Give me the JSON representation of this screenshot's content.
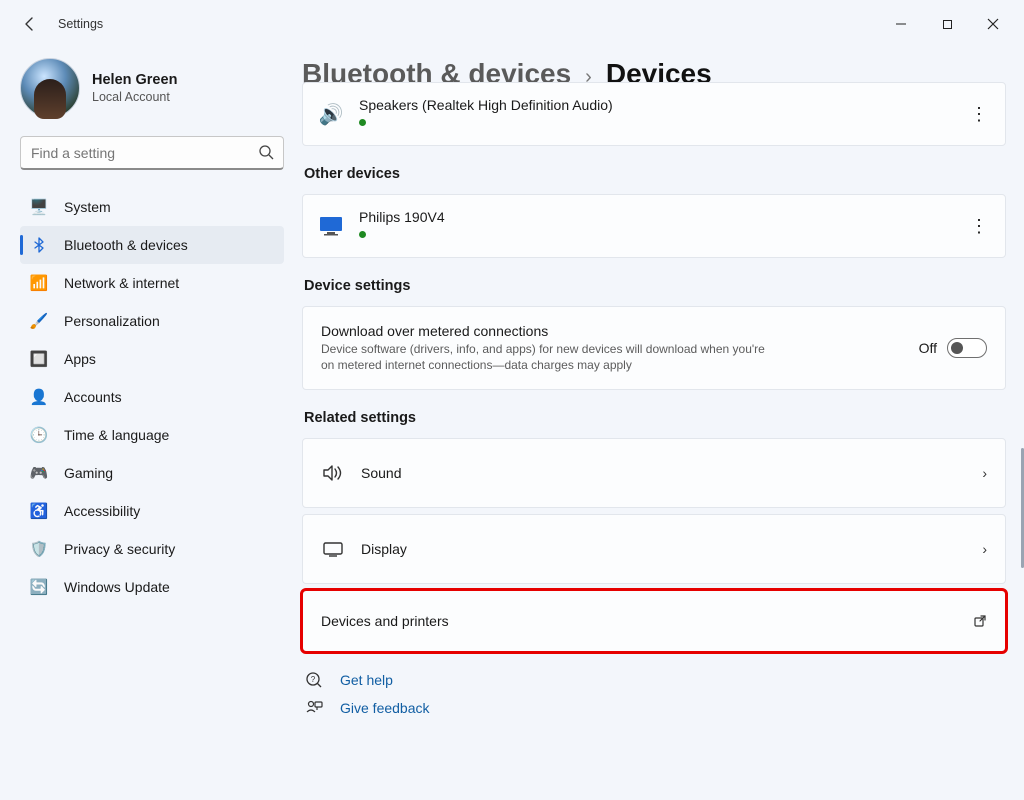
{
  "window": {
    "title": "Settings"
  },
  "profile": {
    "name": "Helen Green",
    "sub": "Local Account"
  },
  "search": {
    "placeholder": "Find a setting"
  },
  "nav": [
    {
      "id": "system",
      "label": "System"
    },
    {
      "id": "bluetooth",
      "label": "Bluetooth & devices"
    },
    {
      "id": "network",
      "label": "Network & internet"
    },
    {
      "id": "personalization",
      "label": "Personalization"
    },
    {
      "id": "apps",
      "label": "Apps"
    },
    {
      "id": "accounts",
      "label": "Accounts"
    },
    {
      "id": "time",
      "label": "Time & language"
    },
    {
      "id": "gaming",
      "label": "Gaming"
    },
    {
      "id": "accessibility",
      "label": "Accessibility"
    },
    {
      "id": "privacy",
      "label": "Privacy & security"
    },
    {
      "id": "update",
      "label": "Windows Update"
    }
  ],
  "breadcrumb": {
    "parent": "Bluetooth & devices",
    "current": "Devices"
  },
  "audio_section": {
    "device_name": "Speakers (Realtek High Definition Audio)"
  },
  "other_devices": {
    "title": "Other devices",
    "device_name": "Philips 190V4"
  },
  "device_settings": {
    "title": "Device settings",
    "metered_label": "Download over metered connections",
    "metered_desc": "Device software (drivers, info, and apps) for new devices will download when you're on metered internet connections—data charges may apply",
    "toggle_state_label": "Off"
  },
  "related": {
    "title": "Related settings",
    "sound": "Sound",
    "display": "Display",
    "devprinters": "Devices and printers"
  },
  "help": {
    "get_help": "Get help",
    "give_feedback": "Give feedback"
  }
}
